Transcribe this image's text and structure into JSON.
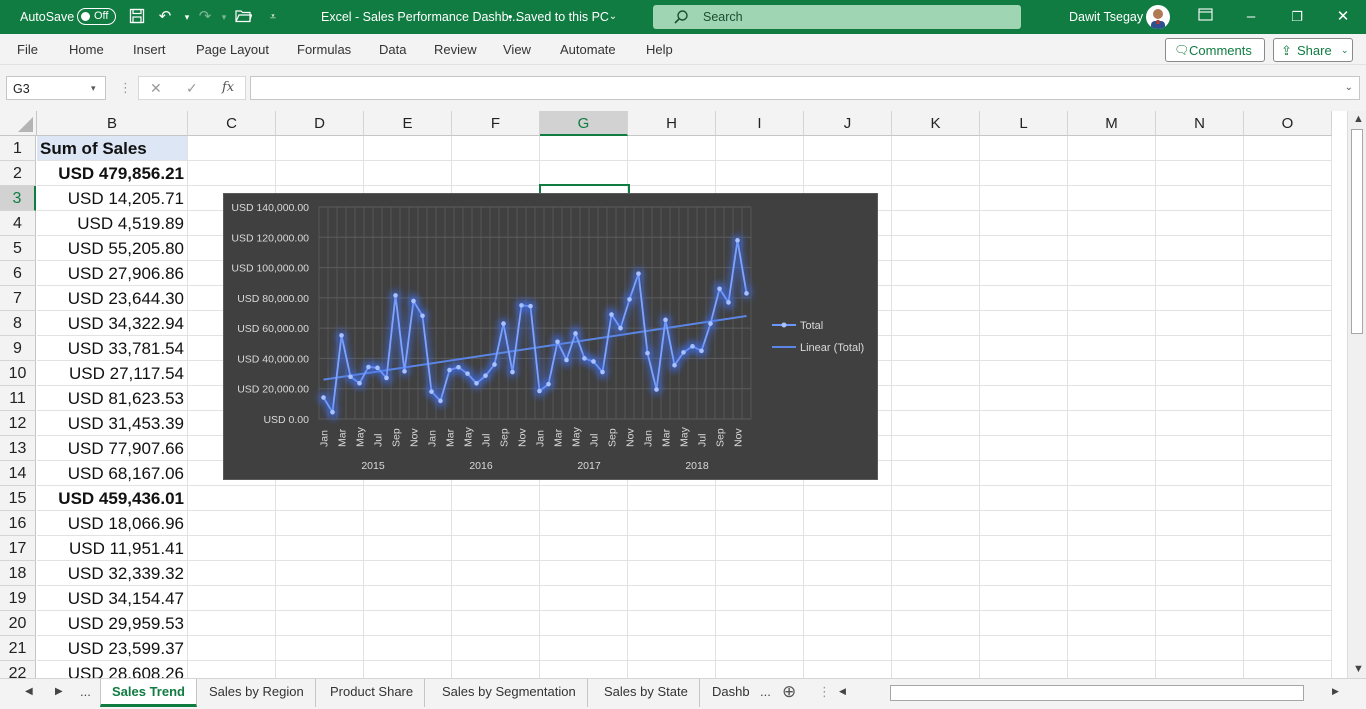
{
  "titlebar": {
    "autosave": "AutoSave",
    "autosave_state": "Off",
    "title": "Excel - Sales Performance Dashb...",
    "saved": "• Saved to this PC",
    "search_placeholder": "Search",
    "user": "Dawit Tsegay"
  },
  "menu": [
    "File",
    "Home",
    "Insert",
    "Page Layout",
    "Formulas",
    "Data",
    "Review",
    "View",
    "Automate",
    "Help"
  ],
  "ribbon": {
    "comments": "Comments",
    "share": "Share"
  },
  "formula_bar": {
    "name_box": "G3",
    "fx": "fx",
    "formula": ""
  },
  "columns": [
    "B",
    "C",
    "D",
    "E",
    "F",
    "G",
    "H",
    "I",
    "J",
    "K",
    "L",
    "M",
    "N",
    "O"
  ],
  "selected_column": "G",
  "selected_row": "3",
  "rows": [
    {
      "n": "1",
      "b": "Sum of Sales",
      "style": "hdr"
    },
    {
      "n": "2",
      "b": "USD 479,856.21",
      "style": "bold"
    },
    {
      "n": "3",
      "b": "USD 14,205.71",
      "style": ""
    },
    {
      "n": "4",
      "b": "USD 4,519.89",
      "style": ""
    },
    {
      "n": "5",
      "b": "USD 55,205.80",
      "style": ""
    },
    {
      "n": "6",
      "b": "USD 27,906.86",
      "style": ""
    },
    {
      "n": "7",
      "b": "USD 23,644.30",
      "style": ""
    },
    {
      "n": "8",
      "b": "USD 34,322.94",
      "style": ""
    },
    {
      "n": "9",
      "b": "USD 33,781.54",
      "style": ""
    },
    {
      "n": "10",
      "b": "USD 27,117.54",
      "style": ""
    },
    {
      "n": "11",
      "b": "USD 81,623.53",
      "style": ""
    },
    {
      "n": "12",
      "b": "USD 31,453.39",
      "style": ""
    },
    {
      "n": "13",
      "b": "USD 77,907.66",
      "style": ""
    },
    {
      "n": "14",
      "b": "USD 68,167.06",
      "style": ""
    },
    {
      "n": "15",
      "b": "USD 459,436.01",
      "style": "bold"
    },
    {
      "n": "16",
      "b": "USD 18,066.96",
      "style": ""
    },
    {
      "n": "17",
      "b": "USD 11,951.41",
      "style": ""
    },
    {
      "n": "18",
      "b": "USD 32,339.32",
      "style": ""
    },
    {
      "n": "19",
      "b": "USD 34,154.47",
      "style": ""
    },
    {
      "n": "20",
      "b": "USD 29,959.53",
      "style": ""
    },
    {
      "n": "21",
      "b": "USD 23,599.37",
      "style": ""
    },
    {
      "n": "22",
      "b": "USD 28,608.26",
      "style": ""
    }
  ],
  "sheet_tabs": [
    "Sales Trend",
    "Sales by Region",
    "Product Share",
    "Sales by Segmentation",
    "Sales by State",
    "Dashb"
  ],
  "active_tab": "Sales Trend",
  "tab_overflow": "...",
  "colors": {
    "excel_green": "#107c41",
    "chart_bg": "#404040",
    "series": "#4f81f0"
  },
  "chart_data": {
    "type": "line",
    "y_ticks": [
      "USD 140,000.00",
      "USD 120,000.00",
      "USD 100,000.00",
      "USD 80,000.00",
      "USD 60,000.00",
      "USD 40,000.00",
      "USD 20,000.00",
      "USD 0.00"
    ],
    "ylim": [
      0,
      140000
    ],
    "month_ticks": [
      "Jan",
      "Mar",
      "May",
      "Jul",
      "Sep",
      "Nov"
    ],
    "years": [
      "2015",
      "2016",
      "2017",
      "2018"
    ],
    "series": [
      {
        "name": "Total",
        "values": [
          14205.71,
          4519.89,
          55205.8,
          27906.86,
          23644.3,
          34322.94,
          33781.54,
          27117.54,
          81623.53,
          31453.39,
          77907.66,
          68167.06,
          18066.96,
          11951.41,
          32339.32,
          34154.47,
          29959.53,
          23599.37,
          28608.26,
          36000,
          63000,
          31000,
          75000,
          74500,
          18500,
          23000,
          51000,
          39000,
          56500,
          40000,
          38000,
          31000,
          69000,
          60000,
          79000,
          96000,
          43500,
          19500,
          65500,
          35500,
          44000,
          48000,
          45000,
          63000,
          86000,
          77000,
          118000,
          83000
        ]
      },
      {
        "name": "Linear (Total)",
        "trend": [
          26000,
          68000
        ]
      }
    ],
    "legend": [
      "Total",
      "Linear (Total)"
    ],
    "legend_position": "right",
    "grid": true
  }
}
